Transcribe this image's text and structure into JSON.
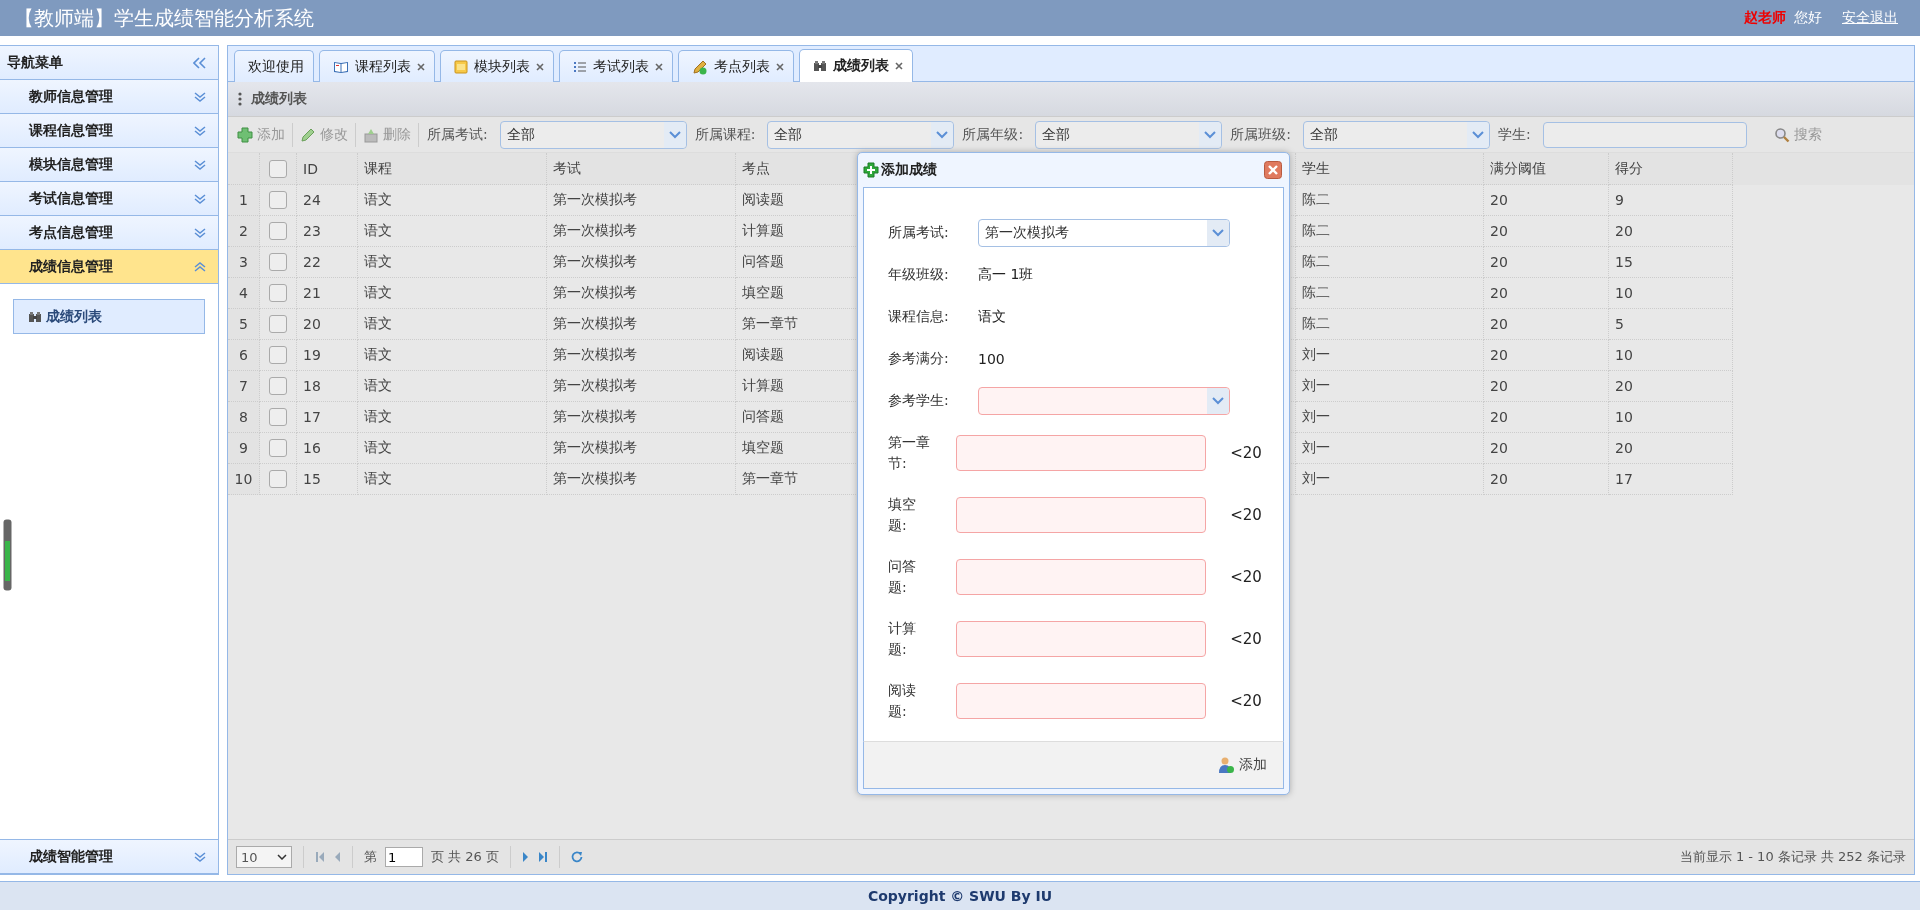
{
  "header": {
    "title": "【教师端】学生成绩智能分析系统",
    "user": "赵老师",
    "greeting": "您好",
    "logout": "安全退出"
  },
  "sidebar": {
    "title": "导航菜单",
    "groups": [
      {
        "label": "教师信息管理",
        "expanded": false
      },
      {
        "label": "课程信息管理",
        "expanded": false
      },
      {
        "label": "模块信息管理",
        "expanded": false
      },
      {
        "label": "考试信息管理",
        "expanded": false
      },
      {
        "label": "考点信息管理",
        "expanded": false
      },
      {
        "label": "成绩信息管理",
        "expanded": true,
        "children": [
          {
            "label": "成绩列表",
            "selected": true
          }
        ]
      },
      {
        "label": "成绩智能管理",
        "expanded": false
      }
    ]
  },
  "tabs": [
    {
      "label": "欢迎使用",
      "selected": false,
      "closable": false
    },
    {
      "label": "课程列表",
      "selected": false,
      "closable": true
    },
    {
      "label": "模块列表",
      "selected": false,
      "closable": true
    },
    {
      "label": "考试列表",
      "selected": false,
      "closable": true
    },
    {
      "label": "考点列表",
      "selected": false,
      "closable": true
    },
    {
      "label": "成绩列表",
      "selected": true,
      "closable": true
    }
  ],
  "panel_title": "成绩列表",
  "toolbar": {
    "buttons": [
      "添加",
      "修改",
      "删除"
    ],
    "filters": [
      {
        "kind": "combo",
        "label": "所属考试:",
        "value": "全部"
      },
      {
        "kind": "combo",
        "label": "所属课程:",
        "value": "全部"
      },
      {
        "kind": "combo",
        "label": "所属年级:",
        "value": "全部"
      },
      {
        "kind": "combo",
        "label": "所属班级:",
        "value": "全部"
      },
      {
        "kind": "text",
        "label": "学生:"
      }
    ],
    "search": "搜索"
  },
  "table": {
    "header_checked": false,
    "columns": [
      "ID",
      "课程",
      "考试",
      "考点",
      "学生",
      "满分阈值",
      "得分"
    ],
    "rows": [
      {
        "number": "1",
        "checked": false,
        "cells": [
          "24",
          "语文",
          "第一次模拟考",
          "阅读题",
          "陈二",
          "20",
          "9"
        ]
      },
      {
        "number": "2",
        "checked": false,
        "cells": [
          "23",
          "语文",
          "第一次模拟考",
          "计算题",
          "陈二",
          "20",
          "20"
        ]
      },
      {
        "number": "3",
        "checked": false,
        "cells": [
          "22",
          "语文",
          "第一次模拟考",
          "问答题",
          "陈二",
          "20",
          "15"
        ]
      },
      {
        "number": "4",
        "checked": false,
        "cells": [
          "21",
          "语文",
          "第一次模拟考",
          "填空题",
          "陈二",
          "20",
          "10"
        ]
      },
      {
        "number": "5",
        "checked": false,
        "cells": [
          "20",
          "语文",
          "第一次模拟考",
          "第一章节",
          "陈二",
          "20",
          "5"
        ]
      },
      {
        "number": "6",
        "checked": false,
        "cells": [
          "19",
          "语文",
          "第一次模拟考",
          "阅读题",
          "刘一",
          "20",
          "10"
        ]
      },
      {
        "number": "7",
        "checked": false,
        "cells": [
          "18",
          "语文",
          "第一次模拟考",
          "计算题",
          "刘一",
          "20",
          "20"
        ]
      },
      {
        "number": "8",
        "checked": false,
        "cells": [
          "17",
          "语文",
          "第一次模拟考",
          "问答题",
          "刘一",
          "20",
          "10"
        ]
      },
      {
        "number": "9",
        "checked": false,
        "cells": [
          "16",
          "语文",
          "第一次模拟考",
          "填空题",
          "刘一",
          "20",
          "20"
        ]
      },
      {
        "number": "10",
        "checked": false,
        "cells": [
          "15",
          "语文",
          "第一次模拟考",
          "第一章节",
          "刘一",
          "20",
          "17"
        ]
      }
    ]
  },
  "pager": {
    "page_size": "10",
    "before": "第",
    "page": "1",
    "after": "页 共 26 页",
    "summary": "当前显示 1 - 10 条记录 共 252 条记录"
  },
  "dialog": {
    "title": "添加成绩",
    "fields": [
      {
        "kind": "combo",
        "label": "所属考试:",
        "value": "第一次模拟考",
        "invalid": false
      },
      {
        "kind": "text",
        "label": "年级班级:",
        "value": "高一 1班"
      },
      {
        "kind": "text",
        "label": "课程信息:",
        "value": "语文"
      },
      {
        "kind": "text",
        "label": "参考满分:",
        "value": "100"
      },
      {
        "kind": "combo",
        "label": "参考学生:",
        "invalid": true
      },
      {
        "kind": "input",
        "label": "第一章节:",
        "hint": "<20",
        "invalid": true
      },
      {
        "kind": "input",
        "label": "填空题:",
        "hint": "<20",
        "invalid": true
      },
      {
        "kind": "input",
        "label": "问答题:",
        "hint": "<20",
        "invalid": true
      },
      {
        "kind": "input",
        "label": "计算题:",
        "hint": "<20",
        "invalid": true
      },
      {
        "kind": "input",
        "label": "阅读题:",
        "hint": "<20",
        "invalid": true
      }
    ],
    "button": "添加"
  },
  "footer": "Copyright © SWU By IU"
}
